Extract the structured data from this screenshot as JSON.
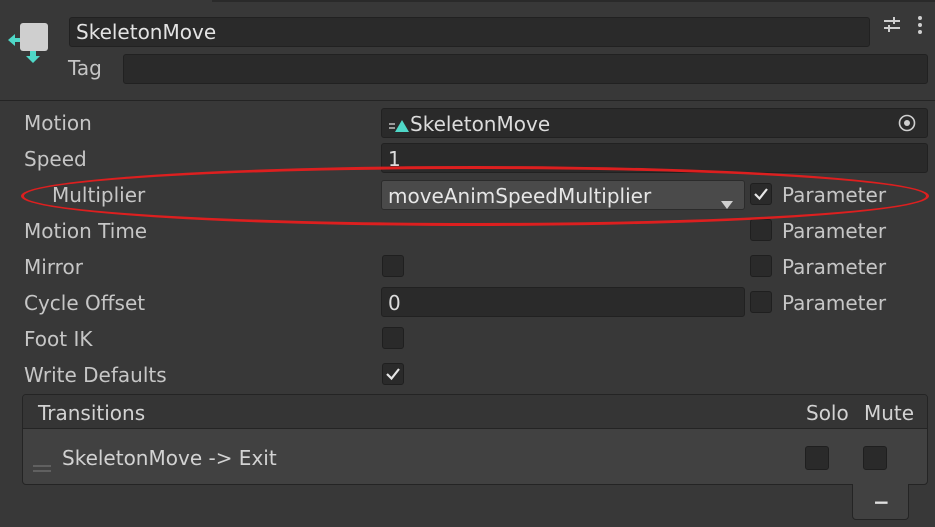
{
  "header": {
    "name": "SkeletonMove",
    "tag_label": "Tag",
    "tag_value": "",
    "icon": "animator-state-icon",
    "settings_icon": "sliders-icon",
    "menu_icon": "kebab-menu-icon"
  },
  "properties": {
    "motion": {
      "label": "Motion",
      "value": "SkeletonMove",
      "icon": "animation-clip-icon",
      "picker_icon": "object-picker-icon"
    },
    "speed": {
      "label": "Speed",
      "value": "1"
    },
    "multiplier": {
      "label": "Multiplier",
      "value": "moveAnimSpeedMultiplier",
      "param_checked": true,
      "param_label": "Parameter"
    },
    "motion_time": {
      "label": "Motion Time",
      "param_checked": false,
      "param_label": "Parameter"
    },
    "mirror": {
      "label": "Mirror",
      "checked": false,
      "param_checked": false,
      "param_label": "Parameter"
    },
    "cycle_offset": {
      "label": "Cycle Offset",
      "value": "0",
      "param_checked": false,
      "param_label": "Parameter"
    },
    "foot_ik": {
      "label": "Foot IK",
      "checked": false
    },
    "write_defaults": {
      "label": "Write Defaults",
      "checked": true
    }
  },
  "transitions": {
    "title": "Transitions",
    "solo_label": "Solo",
    "mute_label": "Mute",
    "items": [
      {
        "label": "SkeletonMove -> Exit",
        "solo": false,
        "mute": false
      }
    ],
    "remove_label": "−"
  },
  "colors": {
    "background": "#383838",
    "field": "#2a2a2a",
    "highlight_ellipse": "#dd1f1f",
    "icon_teal": "#4fd8c8"
  }
}
